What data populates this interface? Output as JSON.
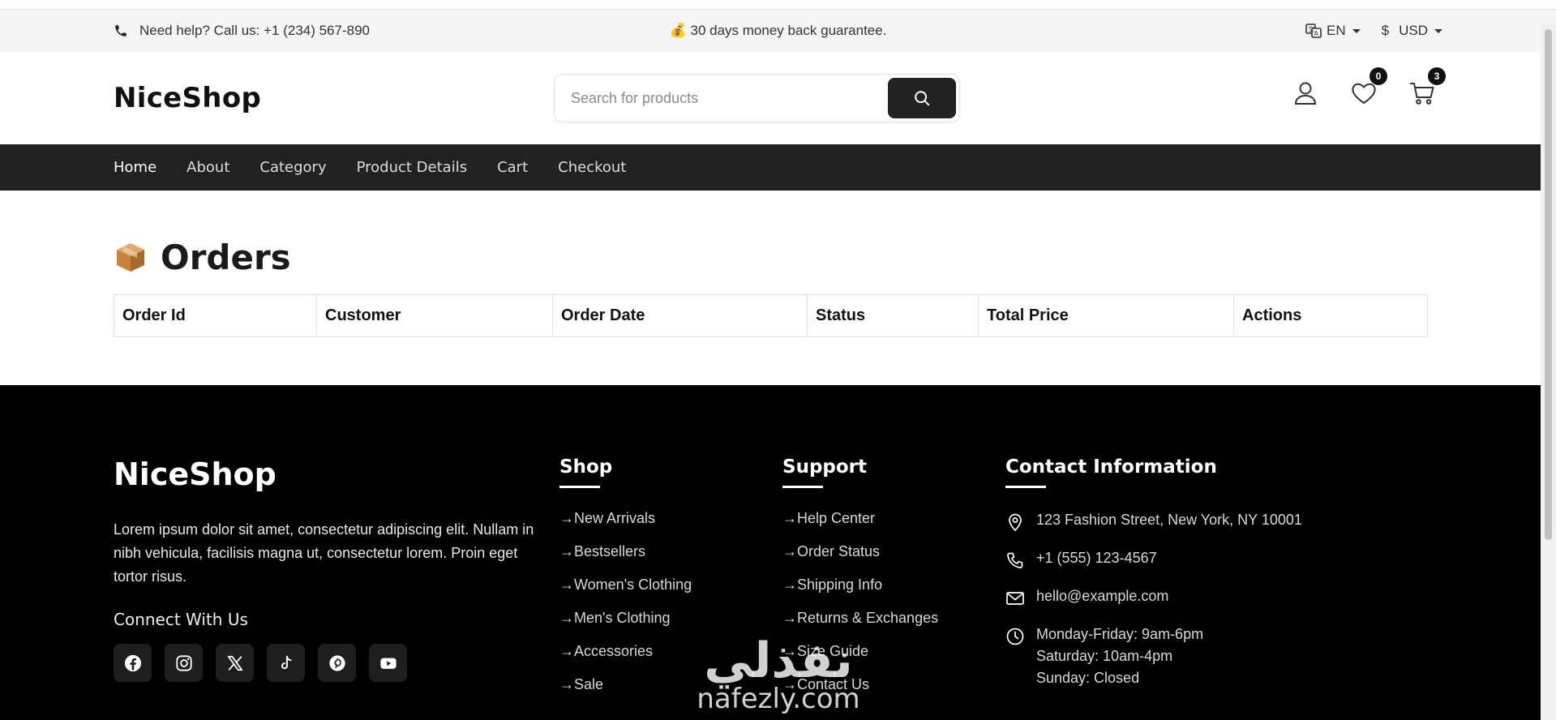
{
  "topbar": {
    "help_text": "Need help? Call us: +1 (234) 567-890",
    "promo_emoji": "💰",
    "promo_text": "30 days money back guarantee.",
    "language": "EN",
    "currency_symbol": "$",
    "currency": "USD"
  },
  "header": {
    "logo": "NiceShop",
    "search_placeholder": "Search for products",
    "wishlist_count": "0",
    "cart_count": "3"
  },
  "nav": {
    "items": [
      {
        "label": "Home"
      },
      {
        "label": "About"
      },
      {
        "label": "Category"
      },
      {
        "label": "Product Details"
      },
      {
        "label": "Cart"
      },
      {
        "label": "Checkout"
      }
    ]
  },
  "main": {
    "title": "Orders",
    "table": {
      "columns": [
        "Order Id",
        "Customer",
        "Order Date",
        "Status",
        "Total Price",
        "Actions"
      ]
    }
  },
  "footer": {
    "logo": "NiceShop",
    "description": "Lorem ipsum dolor sit amet, consectetur adipiscing elit. Nullam in nibh vehicula, facilisis magna ut, consectetur lorem. Proin eget tortor risus.",
    "connect_title": "Connect With Us",
    "shop": {
      "heading": "Shop",
      "links": [
        "New Arrivals",
        "Bestsellers",
        "Women's Clothing",
        "Men's Clothing",
        "Accessories",
        "Sale"
      ]
    },
    "support": {
      "heading": "Support",
      "links": [
        "Help Center",
        "Order Status",
        "Shipping Info",
        "Returns & Exchanges",
        "Size Guide",
        "Contact Us"
      ]
    },
    "contact": {
      "heading": "Contact Information",
      "address": "123 Fashion Street, New York, NY 10001",
      "phone": "+1 (555) 123-4567",
      "email": "hello@example.com",
      "hours_1": "Monday-Friday: 9am-6pm",
      "hours_2": "Saturday: 10am-4pm",
      "hours_3": "Sunday: Closed"
    }
  },
  "watermark": {
    "arabic": "نفذلي",
    "latin": "nafezly.com"
  }
}
